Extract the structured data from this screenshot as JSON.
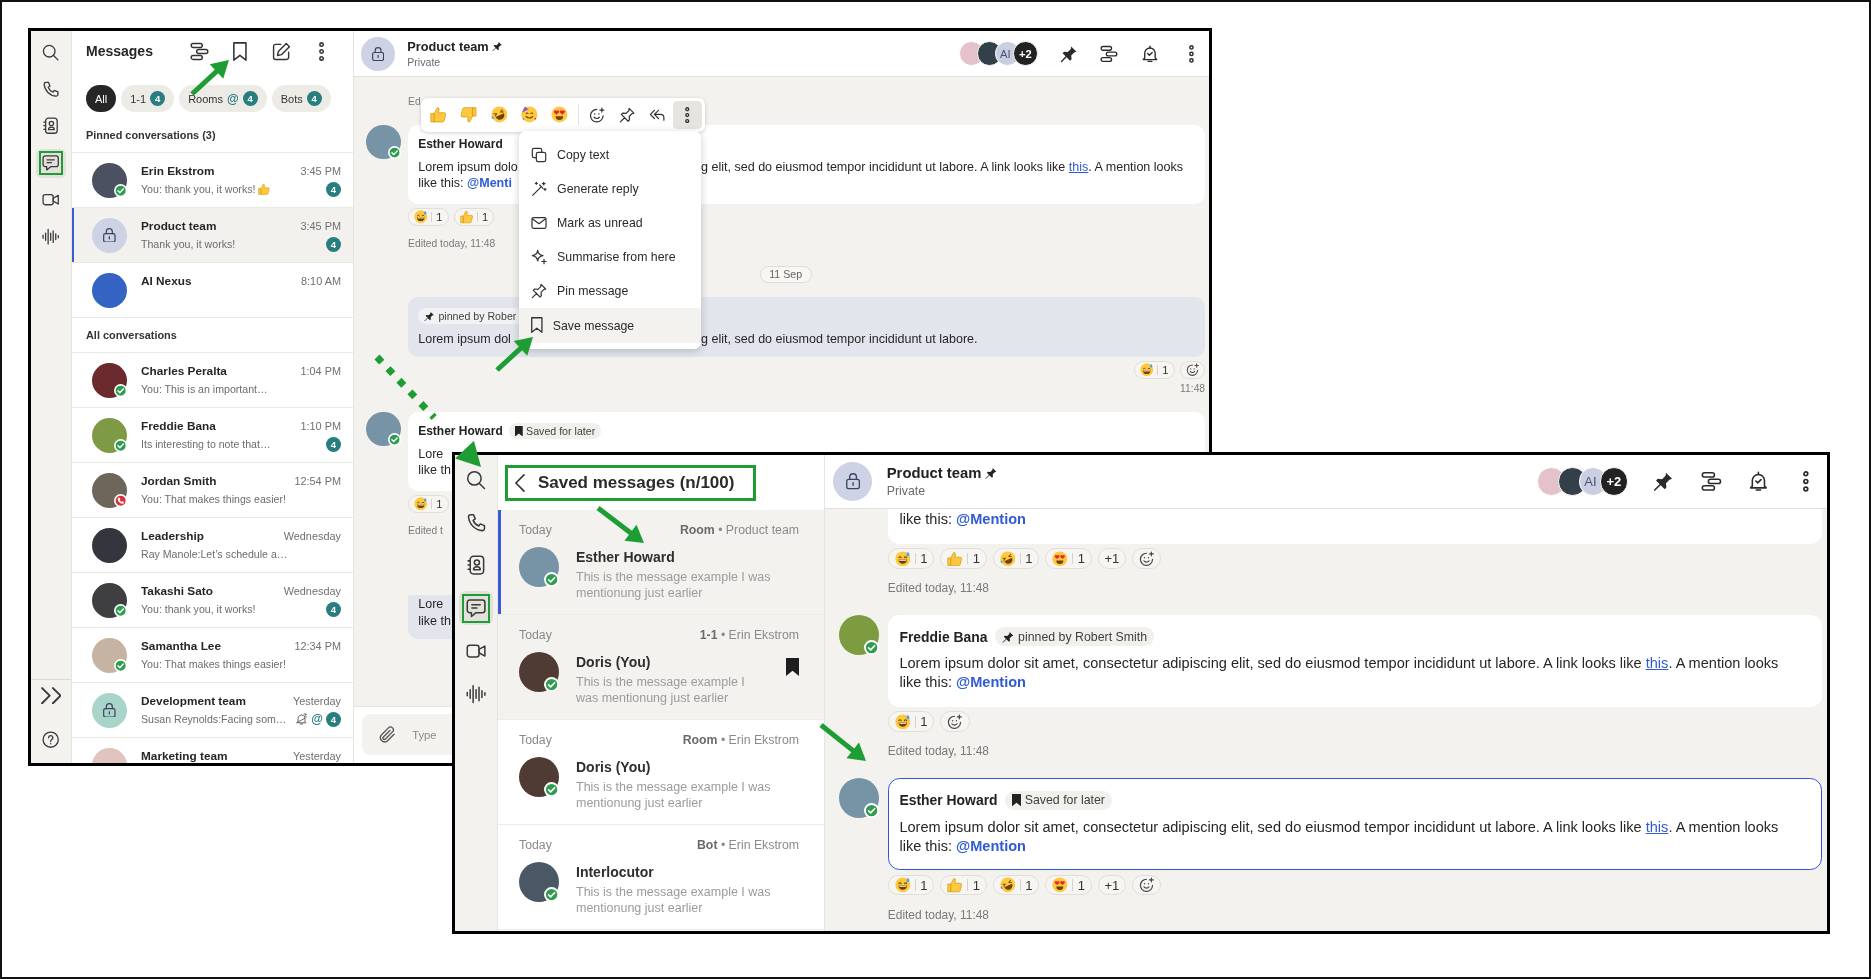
{
  "back_window": {
    "rail": {
      "top": [
        {
          "kind": "search",
          "selected": false,
          "callout": false
        },
        {
          "kind": "calls",
          "selected": false,
          "callout": false
        },
        {
          "kind": "contacts",
          "selected": false,
          "callout": false
        },
        {
          "kind": "chat",
          "selected": true,
          "callout": true
        },
        {
          "kind": "video",
          "selected": false,
          "callout": false
        },
        {
          "kind": "voice",
          "selected": false,
          "callout": false
        }
      ],
      "bottom": [
        {
          "kind": "expand"
        },
        {
          "kind": "help"
        }
      ]
    },
    "panel": {
      "kind": "conversations",
      "title": "Messages",
      "actions": [
        {
          "kind": "threads"
        },
        {
          "kind": "bookmark"
        },
        {
          "kind": "compose"
        },
        {
          "kind": "more"
        }
      ],
      "filters": [
        {
          "label": "All",
          "selected": true
        },
        {
          "label": "1-1",
          "count": "4",
          "selected": false
        },
        {
          "label": "Rooms",
          "mention": "@",
          "count": "4",
          "selected": false
        },
        {
          "label": "Bots",
          "count": "4",
          "selected": false
        }
      ],
      "sections": [
        {
          "title": "Pinned conversations (3)",
          "rows": [
            {
              "name": "Erin Ekstrom",
              "time": "3:45 PM",
              "preview": "You: thank you, it works!",
              "preview_emoji": {
                "kind": "thumbsup"
              },
              "unread": "4",
              "snoozed": false,
              "avatar": {
                "kind": "photo",
                "color": "#4b5160",
                "presence": {
                  "kind": "available"
                }
              },
              "selected": false
            },
            {
              "name": "Product team",
              "time": "3:45 PM",
              "preview": "Thank you, it works!",
              "unread": "4",
              "snoozed": false,
              "avatar": {
                "kind": "lock",
                "color": "#cdd2e4"
              },
              "selected": true
            },
            {
              "name": "AI Nexus",
              "time": "8:10 AM",
              "snoozed": false,
              "avatar": {
                "kind": "photo",
                "color": "#3563c4"
              },
              "selected": false
            }
          ]
        },
        {
          "title": "All conversations",
          "rows": [
            {
              "name": "Charles Peralta",
              "time": "1:04 PM",
              "preview": "You: This is an important…",
              "snoozed": false,
              "avatar": {
                "kind": "photo",
                "color": "#6a2a2e",
                "presence": {
                  "kind": "available"
                }
              },
              "selected": false
            },
            {
              "name": "Freddie Bana",
              "time": "1:10 PM",
              "preview": "Its interesting to note that…",
              "unread": "4",
              "snoozed": false,
              "avatar": {
                "kind": "photo",
                "color": "#7f9a45",
                "presence": {
                  "kind": "available"
                }
              },
              "selected": false
            },
            {
              "name": "Jordan Smith",
              "time": "12:54 PM",
              "preview": "You: That makes things easier!",
              "snoozed": false,
              "avatar": {
                "kind": "photo",
                "color": "#6e6658",
                "presence": {
                  "kind": "in-call"
                }
              },
              "selected": false
            },
            {
              "name": "Leadership",
              "time": "Wednesday",
              "preview": "Ray Manole:Let’s schedule a…",
              "snoozed": false,
              "avatar": {
                "kind": "photo",
                "color": "#35363d"
              },
              "selected": false
            },
            {
              "name": "Takashi Sato",
              "time": "Wednesday",
              "preview": "You: thank you, it works!",
              "unread": "4",
              "snoozed": false,
              "avatar": {
                "kind": "photo",
                "color": "#3f3f42",
                "presence": {
                  "kind": "available"
                }
              },
              "selected": false
            },
            {
              "name": "Samantha Lee",
              "time": "12:34 PM",
              "preview": "You: That makes things easier!",
              "snoozed": false,
              "avatar": {
                "kind": "photo",
                "color": "#c7b3a1",
                "presence": {
                  "kind": "available"
                }
              },
              "selected": false
            },
            {
              "name": "Development team",
              "time": "Yesterday",
              "preview": "Susan Reynolds:Facing som…",
              "snoozed": true,
              "mention": "@",
              "unread": "4",
              "avatar": {
                "kind": "lock",
                "color": "#a8d4ca"
              },
              "selected": false
            },
            {
              "name": "Marketing team",
              "time": "Yesterday",
              "snoozed": false,
              "avatar": {
                "kind": "photo",
                "color": "#e2c4bf"
              },
              "selected": false
            }
          ]
        }
      ]
    },
    "chat": {
      "avatar": {
        "kind": "lock",
        "color": "#cdd2e4"
      },
      "title": "Product team",
      "pinned": true,
      "subtitle": "Private",
      "members": [
        {
          "kind": "photo",
          "color": "#e3c3c9"
        },
        {
          "kind": "photo",
          "color": "#33404a"
        },
        {
          "kind": "initials",
          "label": "AI"
        },
        {
          "kind": "overflow",
          "label": "+2"
        }
      ],
      "actions": [
        {
          "kind": "pin"
        },
        {
          "kind": "threads"
        },
        {
          "kind": "bell"
        },
        {
          "kind": "more"
        }
      ],
      "messages": [
        {
          "kind": "note",
          "text": "Ed"
        },
        {
          "kind": "incoming",
          "author": "Esther Howard",
          "avatar": {
            "kind": "photo",
            "color": "#7793a6",
            "presence": {
              "kind": "available"
            }
          },
          "highlighted": false,
          "body_left": [
            [
              {
                "kind": "text",
                "text": "Lorem ipsum dolo"
              }
            ],
            [
              {
                "kind": "text",
                "text": "like this: "
              },
              {
                "kind": "mention",
                "text": "@Menti"
              }
            ]
          ],
          "body_right": [
            [
              {
                "kind": "text",
                "text": "g elit, sed do eiusmod tempor incididunt ut labore. A link looks like "
              },
              {
                "kind": "link",
                "text": "this"
              },
              {
                "kind": "text",
                "text": ". A mention looks"
              }
            ]
          ],
          "reactions": [
            {
              "kind": "sweat",
              "count": "1"
            },
            {
              "kind": "thumbsup",
              "count": "1"
            }
          ],
          "footer": "Edited today, 11:48",
          "toolbar": {
            "emojis": [
              {
                "kind": "thumbsup"
              },
              {
                "kind": "thumbsdown"
              },
              {
                "kind": "rofl"
              },
              {
                "kind": "party"
              },
              {
                "kind": "hearteyes"
              }
            ],
            "actions": [
              {
                "kind": "react",
                "active": false
              },
              {
                "kind": "pin",
                "active": false
              },
              {
                "kind": "reply-all",
                "active": false
              },
              {
                "kind": "more",
                "active": true
              }
            ]
          },
          "menu": [
            {
              "kind": "copy",
              "label": "Copy text",
              "hovered": false
            },
            {
              "kind": "wand",
              "label": "Generate reply",
              "hovered": false
            },
            {
              "kind": "mail",
              "label": "Mark as unread",
              "hovered": false
            },
            {
              "kind": "sparkle",
              "label": "Summarise from here",
              "hovered": false
            },
            {
              "kind": "pin",
              "label": "Pin message",
              "hovered": false
            },
            {
              "kind": "bookmark",
              "label": "Save message",
              "hovered": true
            }
          ]
        },
        {
          "kind": "date",
          "text": "11 Sep"
        },
        {
          "kind": "own",
          "tag": {
            "kind": "pinned",
            "label": "pinned by Rober"
          },
          "body_left": [
            [
              {
                "kind": "text",
                "text": "Lorem ipsum dol"
              }
            ]
          ],
          "body_right": [
            [
              {
                "kind": "text",
                "text": "g elit, sed do eiusmod tempor incididunt ut labore."
              }
            ]
          ],
          "reactions": [
            {
              "kind": "sweat",
              "count": "1"
            },
            {
              "kind": "add"
            }
          ],
          "footer": "11:48"
        },
        {
          "kind": "incoming",
          "author": "Esther Howard",
          "avatar": {
            "kind": "photo",
            "color": "#7793a6",
            "presence": {
              "kind": "available"
            }
          },
          "highlighted": false,
          "tag": {
            "kind": "saved",
            "label": "Saved for later"
          },
          "body_left": [
            [
              {
                "kind": "text",
                "text": "Lore"
              }
            ],
            [
              {
                "kind": "text",
                "text": "like th"
              }
            ]
          ],
          "reactions": [
            {
              "kind": "sweat",
              "count": "1"
            }
          ],
          "footer": "Edited t"
        },
        {
          "kind": "own",
          "body_left": [
            [
              {
                "kind": "text",
                "text": "Lore"
              }
            ],
            [
              {
                "kind": "text",
                "text": "like th"
              }
            ]
          ]
        }
      ],
      "compose": {
        "placeholder": "Type"
      }
    }
  },
  "front_window": {
    "rail": {
      "top": [
        {
          "kind": "search",
          "selected": false,
          "callout": false
        },
        {
          "kind": "calls",
          "selected": false,
          "callout": false
        },
        {
          "kind": "contacts",
          "selected": false,
          "callout": false
        },
        {
          "kind": "chat",
          "selected": true,
          "callout": true
        },
        {
          "kind": "video",
          "selected": false,
          "callout": false
        },
        {
          "kind": "voice",
          "selected": false,
          "callout": false
        }
      ]
    },
    "panel": {
      "kind": "saved",
      "title": "Saved messages (n/100)",
      "callout": true,
      "items": [
        {
          "date": "Today",
          "source": "**Room** • Product team",
          "name": "Esther Howard",
          "preview": "This is the message example I was mentionung just earlier",
          "avatar": {
            "kind": "photo",
            "color": "#7793a6",
            "presence": {
              "kind": "available"
            }
          },
          "selected": true,
          "hovered": false
        },
        {
          "date": "Today",
          "source": "**1-1** • Erin Ekstrom",
          "name": "Doris (You)",
          "preview": "This is the message example I was mentionung just earlier",
          "avatar": {
            "kind": "photo",
            "color": "#4f3b33",
            "presence": {
              "kind": "available"
            }
          },
          "selected": false,
          "hovered": true
        },
        {
          "date": "Today",
          "source": "**Room** • Erin Ekstrom",
          "name": "Doris (You)",
          "preview": "This is the message example I was mentionung just earlier",
          "avatar": {
            "kind": "photo",
            "color": "#4f3b33",
            "presence": {
              "kind": "available"
            }
          },
          "selected": false,
          "hovered": false
        },
        {
          "date": "Today",
          "source": "**Bot** • Erin Ekstrom",
          "name": "Interlocutor",
          "preview": "This is the message example I was mentionung just earlier",
          "avatar": {
            "kind": "photo",
            "color": "#4a5866",
            "presence": {
              "kind": "available"
            }
          },
          "selected": false,
          "hovered": false
        }
      ]
    },
    "chat": {
      "avatar": {
        "kind": "lock",
        "color": "#cdd2e4"
      },
      "title": "Product team",
      "pinned": true,
      "subtitle": "Private",
      "members": [
        {
          "kind": "photo",
          "color": "#e3c3c9"
        },
        {
          "kind": "photo",
          "color": "#33404a"
        },
        {
          "kind": "initials",
          "label": "AI"
        },
        {
          "kind": "overflow",
          "label": "+2"
        }
      ],
      "actions": [
        {
          "kind": "pin"
        },
        {
          "kind": "threads"
        },
        {
          "kind": "bell"
        },
        {
          "kind": "more"
        }
      ],
      "messages": [
        {
          "kind": "incoming",
          "highlighted": false,
          "body": [
            {
              "kind": "text",
              "text": "like this: "
            },
            {
              "kind": "mention",
              "text": "@Mention"
            }
          ],
          "reactions": [
            {
              "kind": "sweat",
              "count": "1"
            },
            {
              "kind": "thumbsup",
              "count": "1"
            },
            {
              "kind": "rofl",
              "count": "1"
            },
            {
              "kind": "hearteyes",
              "count": "1"
            },
            {
              "kind": "more",
              "label": "+1"
            },
            {
              "kind": "add"
            }
          ],
          "footer": "Edited today, 11:48"
        },
        {
          "kind": "incoming",
          "author": "Freddie Bana",
          "avatar": {
            "kind": "photo",
            "color": "#7c9c3f",
            "presence": {
              "kind": "available"
            }
          },
          "highlighted": false,
          "tag": {
            "kind": "pinned",
            "label": "pinned by Robert Smith"
          },
          "body": [
            {
              "kind": "text",
              "text": "Lorem ipsum dolor sit amet, consectetur adipiscing elit, sed do eiusmod tempor incididunt ut labore. A link looks like "
            },
            {
              "kind": "link",
              "text": "this"
            },
            {
              "kind": "text",
              "text": ". A mention looks like this: "
            },
            {
              "kind": "mention",
              "text": "@Mention"
            }
          ],
          "reactions": [
            {
              "kind": "sweat",
              "count": "1"
            },
            {
              "kind": "add"
            }
          ],
          "footer": "Edited today, 11:48"
        },
        {
          "kind": "incoming",
          "author": "Esther Howard",
          "avatar": {
            "kind": "photo",
            "color": "#7793a6",
            "presence": {
              "kind": "available"
            }
          },
          "highlighted": true,
          "tag": {
            "kind": "saved",
            "label": "Saved for later"
          },
          "body": [
            {
              "kind": "text",
              "text": "Lorem ipsum dolor sit amet, consectetur adipiscing elit, sed do eiusmod tempor incididunt ut labore. A link looks like "
            },
            {
              "kind": "link",
              "text": "this"
            },
            {
              "kind": "text",
              "text": ". A mention looks like this: "
            },
            {
              "kind": "mention",
              "text": "@Mention"
            }
          ],
          "reactions": [
            {
              "kind": "sweat",
              "count": "1"
            },
            {
              "kind": "thumbsup",
              "count": "1"
            },
            {
              "kind": "rofl",
              "count": "1"
            },
            {
              "kind": "hearteyes",
              "count": "1"
            },
            {
              "kind": "more",
              "label": "+1"
            },
            {
              "kind": "add"
            }
          ],
          "footer": "Edited today, 11:48"
        }
      ]
    }
  },
  "annotations": [
    {
      "kind": "arrow"
    },
    {
      "kind": "arrow"
    },
    {
      "kind": "dotted-arrow"
    },
    {
      "kind": "arrow"
    },
    {
      "kind": "arrow"
    }
  ]
}
